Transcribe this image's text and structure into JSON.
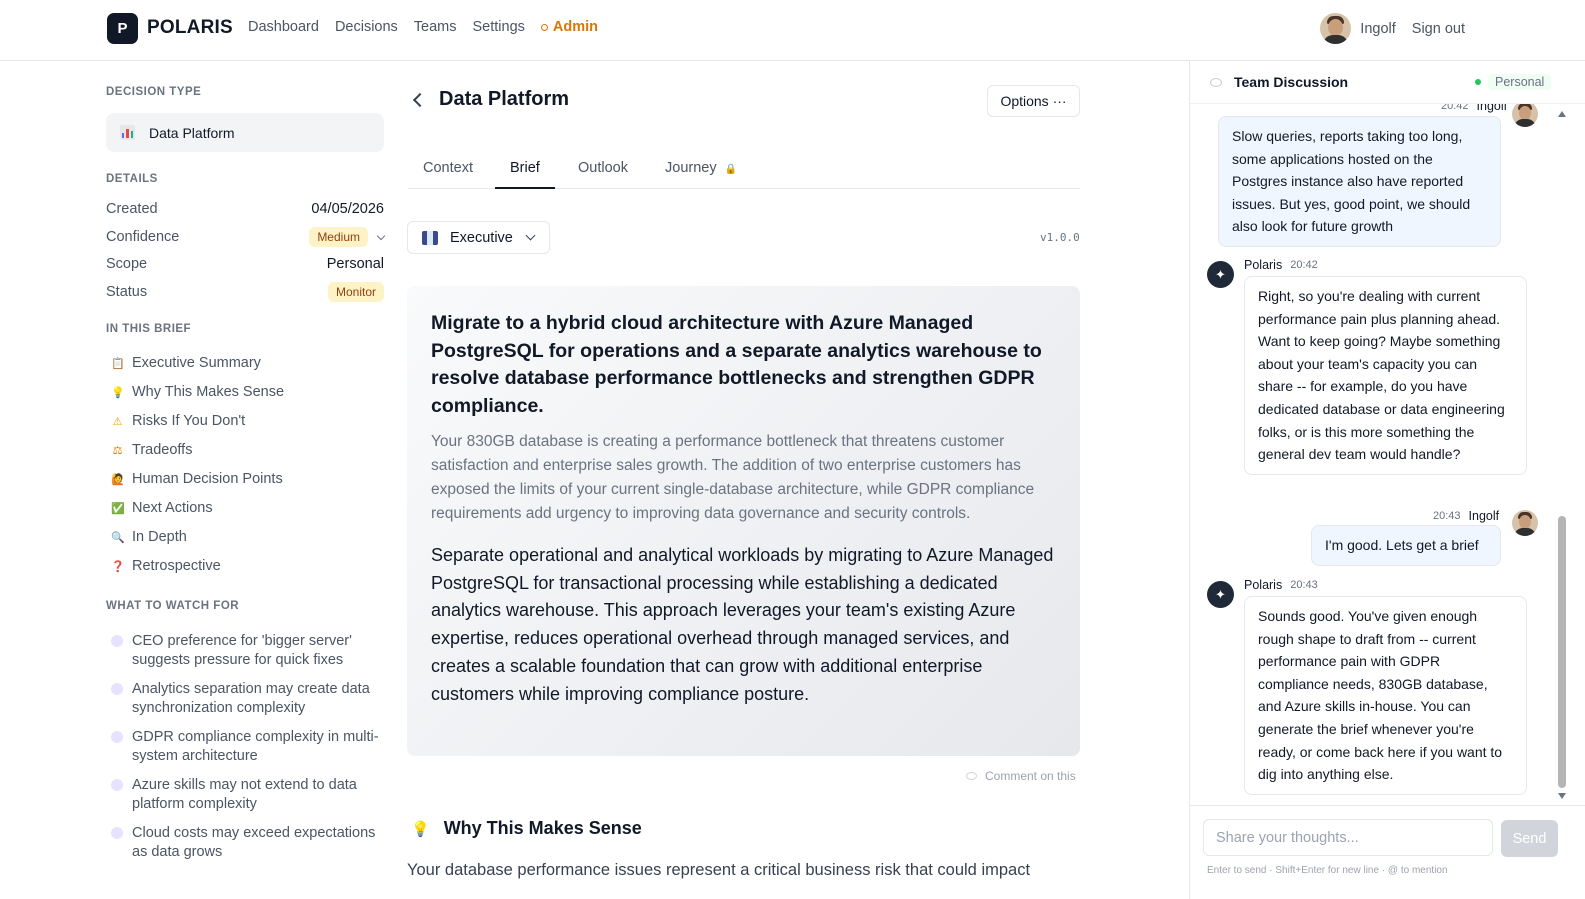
{
  "brand": {
    "logo_letter": "P",
    "name": "POLARIS"
  },
  "nav": {
    "items": [
      "Dashboard",
      "Decisions",
      "Teams",
      "Settings"
    ],
    "admin": "Admin"
  },
  "user": {
    "name": "Ingolf",
    "signout": "Sign out"
  },
  "sidebar": {
    "decision_type_heading": "DECISION TYPE",
    "decision_type": "Data Platform",
    "details_heading": "DETAILS",
    "details": [
      {
        "label": "Created",
        "value": "04/05/2026"
      },
      {
        "label": "Confidence",
        "value": "Medium"
      },
      {
        "label": "Scope",
        "value": "Personal"
      },
      {
        "label": "Status",
        "value": "Monitor"
      }
    ],
    "brief_heading": "IN THIS BRIEF",
    "brief_items": [
      {
        "icon": "📋",
        "label": "Executive Summary"
      },
      {
        "icon": "💡",
        "label": "Why This Makes Sense"
      },
      {
        "icon": "⚠",
        "label": "Risks If You Don't"
      },
      {
        "icon": "⚖",
        "label": "Tradeoffs"
      },
      {
        "icon": "🙋",
        "label": "Human Decision Points"
      },
      {
        "icon": "✅",
        "label": "Next Actions"
      },
      {
        "icon": "🔍",
        "label": "In Depth"
      },
      {
        "icon": "❓",
        "label": "Retrospective"
      }
    ],
    "watch_heading": "WHAT TO WATCH FOR",
    "watch_items": [
      "CEO preference for 'bigger server' suggests pressure for quick fixes",
      "Analytics separation may create data synchronization complexity",
      "GDPR compliance complexity in multi-system architecture",
      "Azure skills may not extend to data platform complexity",
      "Cloud costs may exceed expectations as data grows"
    ]
  },
  "main": {
    "title": "Data Platform",
    "options": "Options ···",
    "tabs": [
      "Context",
      "Brief",
      "Outlook",
      "Journey"
    ],
    "journey_lock": "🔒",
    "view_select": "Executive",
    "version": "v1.0.0",
    "headline": "Migrate to a hybrid cloud architecture with Azure Managed PostgreSQL for operations and a separate analytics warehouse to resolve database performance bottlenecks and strengthen GDPR compliance.",
    "subtext": "Your 830GB database is creating a performance bottleneck that threatens customer satisfaction and enterprise sales growth. The addition of two enterprise customers has exposed the limits of your current single-database architecture, while GDPR compliance requirements add urgency to improving data governance and security controls.",
    "recommendation": "Separate operational and analytical workloads by migrating to Azure Managed PostgreSQL for transactional processing while establishing a dedicated analytics warehouse. This approach leverages your team's existing Azure expertise, reduces operational overhead through managed services, and creates a scalable foundation that can grow with additional enterprise customers while improving compliance posture.",
    "comment_link": "Comment on this",
    "section2_title": "Why This Makes Sense",
    "section2_text": "Your database performance issues represent a critical business risk that could impact"
  },
  "chat": {
    "title": "Team Discussion",
    "scope": "Personal",
    "messages": [
      {
        "author": "Ingolf",
        "time": "20:42",
        "text": "Slow queries, reports taking too long, some applications hosted on the Postgres instance also have reported issues. But yes, good point, we should also look for future growth"
      },
      {
        "author": "Polaris",
        "time": "20:42",
        "text": "Right, so you're dealing with current performance pain plus planning ahead. Want to keep going? Maybe something about your team's capacity you can share -- for example, do you have dedicated database or data engineering folks, or is this more something the general dev team would handle?"
      },
      {
        "author": "Ingolf",
        "time": "20:43",
        "text": "I'm good. Lets get a brief"
      },
      {
        "author": "Polaris",
        "time": "20:43",
        "text": "Sounds good. You've given enough rough shape to draft from -- current performance pain with GDPR compliance needs, 830GB database, and Azure skills in-house. You can generate the brief whenever you're ready, or come back here if you want to dig into anything else."
      }
    ],
    "input_placeholder": "Share your thoughts...",
    "send": "Send",
    "hint": "Enter to send · Shift+Enter for new line · @ to mention"
  },
  "colors": {
    "accent": "#111827",
    "admin": "#d97706",
    "badge_bg": "#fef3c7",
    "online": "#22c55e"
  }
}
